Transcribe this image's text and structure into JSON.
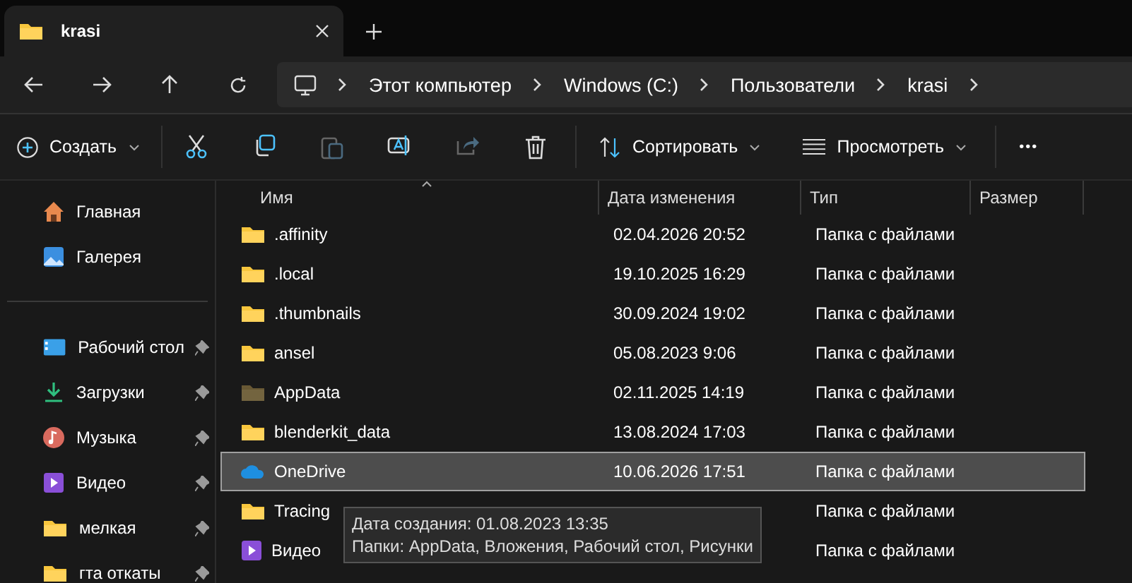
{
  "tabs": [
    {
      "title": "krasi",
      "selected": true
    }
  ],
  "breadcrumb": [
    "Этот компьютер",
    "Windows (C:)",
    "Пользователи",
    "krasi"
  ],
  "toolbar": {
    "create": "Создать",
    "actions": [
      {
        "kind": "cut",
        "disabled": false
      },
      {
        "kind": "copy",
        "disabled": false
      },
      {
        "kind": "paste",
        "disabled": true
      },
      {
        "kind": "rename",
        "disabled": false
      },
      {
        "kind": "share",
        "disabled": true
      },
      {
        "kind": "delete",
        "disabled": false
      }
    ],
    "sort": "Сортировать",
    "view": "Просмотреть",
    "more": "•••"
  },
  "sidebar": {
    "top": [
      {
        "label": "Главная",
        "kind": "home"
      },
      {
        "label": "Галерея",
        "kind": "gallery"
      }
    ],
    "pinned": [
      {
        "label": "Рабочий стол",
        "kind": "desktop"
      },
      {
        "label": "Загрузки",
        "kind": "downloads"
      },
      {
        "label": "Музыка",
        "kind": "music"
      },
      {
        "label": "Видео",
        "kind": "video"
      },
      {
        "label": "мелкая",
        "kind": "folder"
      },
      {
        "label": "гта откаты",
        "kind": "folder"
      }
    ]
  },
  "table": {
    "columns": [
      "Имя",
      "Дата изменения",
      "Тип",
      "Размер"
    ],
    "rows": [
      {
        "name": ".affinity",
        "date": "02.04.2026 20:52",
        "type": "Папка с файлами",
        "kind": "folder",
        "hidden": false,
        "selected": false
      },
      {
        "name": ".local",
        "date": "19.10.2025 16:29",
        "type": "Папка с файлами",
        "kind": "folder",
        "hidden": false,
        "selected": false
      },
      {
        "name": ".thumbnails",
        "date": "30.09.2024 19:02",
        "type": "Папка с файлами",
        "kind": "folder",
        "hidden": false,
        "selected": false
      },
      {
        "name": "ansel",
        "date": "05.08.2023 9:06",
        "type": "Папка с файлами",
        "kind": "folder",
        "hidden": false,
        "selected": false
      },
      {
        "name": "AppData",
        "date": "02.11.2025 14:19",
        "type": "Папка с файлами",
        "kind": "folder",
        "hidden": true,
        "selected": false
      },
      {
        "name": "blenderkit_data",
        "date": "13.08.2024 17:03",
        "type": "Папка с файлами",
        "kind": "folder",
        "hidden": false,
        "selected": false
      },
      {
        "name": "OneDrive",
        "date": "10.06.2026 17:51",
        "type": "Папка с файлами",
        "kind": "onedrive",
        "hidden": false,
        "selected": true
      },
      {
        "name": "Tracing",
        "type": "Папка с файлами",
        "kind": "folder",
        "hidden": false,
        "selected": false
      },
      {
        "name": "Видео",
        "type": "Папка с файлами",
        "kind": "video",
        "hidden": false,
        "selected": false
      }
    ]
  },
  "tooltip": [
    "Дата создания: 01.08.2023 13:35",
    "Папки: AppData, Вложения, Рабочий стол, Рисунки"
  ]
}
